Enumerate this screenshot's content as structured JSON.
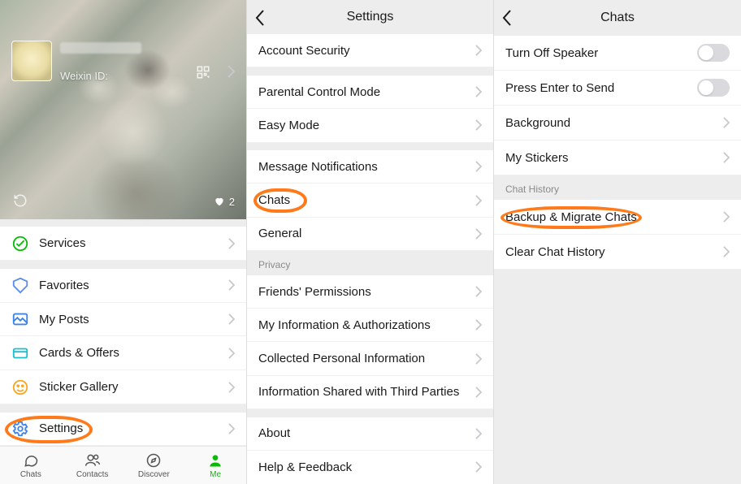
{
  "screen1": {
    "weixin_id_label": "Weixin ID:",
    "likes_count": "2",
    "menu": {
      "services": "Services",
      "favorites": "Favorites",
      "myposts": "My Posts",
      "cardsoffers": "Cards & Offers",
      "stickergallery": "Sticker Gallery",
      "settings": "Settings"
    },
    "tabs": {
      "chats": "Chats",
      "contacts": "Contacts",
      "discover": "Discover",
      "me": "Me"
    }
  },
  "screen2": {
    "title": "Settings",
    "items": {
      "account_security": "Account Security",
      "parental": "Parental Control Mode",
      "easy_mode": "Easy Mode",
      "msg_notif": "Message Notifications",
      "chats": "Chats",
      "general": "General",
      "privacy_header": "Privacy",
      "friends_perm": "Friends' Permissions",
      "my_info_auth": "My Information & Authorizations",
      "collected": "Collected Personal Information",
      "shared_third": "Information Shared with Third Parties",
      "about": "About",
      "help_feedback": "Help & Feedback"
    }
  },
  "screen3": {
    "title": "Chats",
    "items": {
      "turn_off_speaker": "Turn Off Speaker",
      "press_enter": "Press Enter to Send",
      "background": "Background",
      "my_stickers": "My Stickers",
      "chat_history_header": "Chat History",
      "backup_migrate": "Backup & Migrate Chats",
      "clear_history": "Clear Chat History"
    },
    "toggles": {
      "turn_off_speaker": false,
      "press_enter": false
    }
  }
}
